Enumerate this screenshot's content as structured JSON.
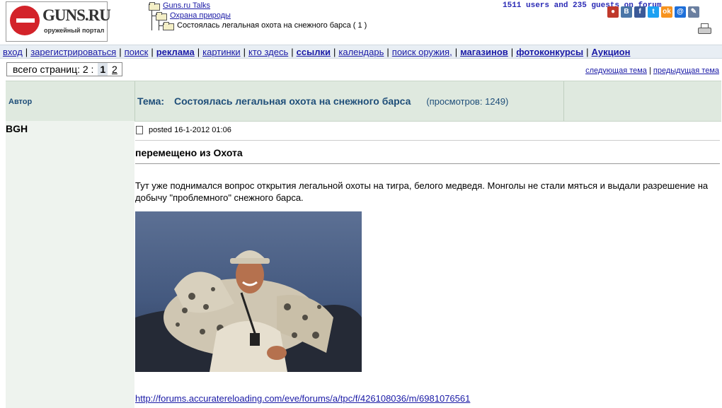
{
  "logo": {
    "brand": "GUNS.RU",
    "subtitle": "оружейный портал"
  },
  "breadcrumb": [
    {
      "label": "Guns.ru Talks"
    },
    {
      "label": "Охрана природы"
    },
    {
      "label": "Состоялась легальная охота на снежного барса ( 1 )"
    }
  ],
  "online": "1511 users and 235 guests on forum",
  "nav": [
    {
      "label": "вход",
      "bold": false
    },
    {
      "label": "зарегистрироваться",
      "bold": false
    },
    {
      "label": "поиск",
      "bold": false
    },
    {
      "label": "реклама",
      "bold": true
    },
    {
      "label": "картинки",
      "bold": false
    },
    {
      "label": "кто здесь",
      "bold": false
    },
    {
      "label": "ссылки",
      "bold": true
    },
    {
      "label": "календарь",
      "bold": false
    },
    {
      "label": "поиск оружия,",
      "bold": false
    },
    {
      "label": "магазинов",
      "bold": true
    },
    {
      "label": "фотоконкурсы",
      "bold": true
    },
    {
      "label": "Аукцион",
      "bold": true
    }
  ],
  "pages": {
    "label": "всего страниц: 2 :",
    "current": "1",
    "other": "2"
  },
  "topic_links": {
    "next": "следующая тема",
    "prev": "предыдущая тема"
  },
  "thread_header": {
    "author_label": "Автор",
    "topic_label": "Тема:",
    "topic_title": "Состоялась легальная охота на снежного барса",
    "views": "(просмотров: 1249)"
  },
  "share_icons": [
    {
      "name": "rss-icon",
      "color": "#c0392b",
      "glyph": "●"
    },
    {
      "name": "vkontakte-icon",
      "color": "#4a76a8",
      "glyph": "B"
    },
    {
      "name": "facebook-icon",
      "color": "#3b5998",
      "glyph": "f"
    },
    {
      "name": "twitter-icon",
      "color": "#1da1f2",
      "glyph": "t"
    },
    {
      "name": "odnoklassniki-icon",
      "color": "#f7931e",
      "glyph": "ok"
    },
    {
      "name": "mail-icon",
      "color": "#1e6fd9",
      "glyph": "@"
    },
    {
      "name": "pencil-icon",
      "color": "#6a7fa0",
      "glyph": "✎"
    }
  ],
  "post": {
    "author": "BGH",
    "posted": "posted 16-1-2012 01:06",
    "title": "перемещено из Охота",
    "body": "Тут уже поднимался вопрос открытия легальной охоты на тигра, белого медведя. Монголы не стали мяться и выдали разрешение на добычу \"проблемного\" снежного барса.",
    "link": "http://forums.accuratereloading.com/eve/forums/a/tpc/f/426108036/m/6981076561"
  }
}
